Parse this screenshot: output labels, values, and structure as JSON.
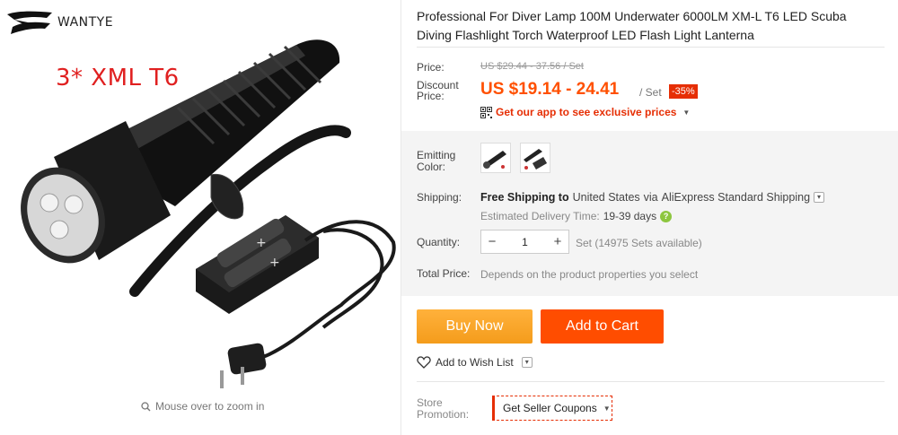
{
  "brand": {
    "name": "WANTYE"
  },
  "gallery": {
    "promo_text": "3* XML T6",
    "zoom_hint": "Mouse over to zoom in"
  },
  "product": {
    "title": "Professional For Diver Lamp 100M Underwater 6000LM XM-L T6 LED Scuba Diving Flashlight Torch Waterproof LED Flash Light Lanterna"
  },
  "price": {
    "label": "Price:",
    "original": "US $29.44 - 37.56 / Set",
    "discount_label": "Discount Price:",
    "discount": "US $19.14 - 24.41",
    "unit": "/ Set",
    "off_badge": "-35%",
    "app_promo": "Get our app to see exclusive prices"
  },
  "options": {
    "emitting_label": "Emitting Color:",
    "swatches": [
      "flashlight-only",
      "flashlight-with-charger"
    ]
  },
  "shipping": {
    "label": "Shipping:",
    "free": "Free Shipping to",
    "destination": "United States",
    "via_text": "via",
    "method": "AliExpress Standard Shipping",
    "eta_label": "Estimated Delivery Time:",
    "eta_days": "19-39 days"
  },
  "quantity": {
    "label": "Quantity:",
    "value": "1",
    "minus": "−",
    "plus": "+",
    "available": "Set (14975 Sets available)"
  },
  "total": {
    "label": "Total Price:",
    "value": "Depends on the product properties you select"
  },
  "actions": {
    "buy_now": "Buy Now",
    "add_to_cart": "Add to Cart",
    "wish_list": "Add to Wish List"
  },
  "store": {
    "label": "Store Promotion:",
    "coupon": "Get Seller Coupons"
  },
  "colors": {
    "accent_orange": "#ff4d00",
    "buy_now": "#f5a623",
    "price_red": "#ff5000",
    "badge_red": "#e62e04"
  }
}
